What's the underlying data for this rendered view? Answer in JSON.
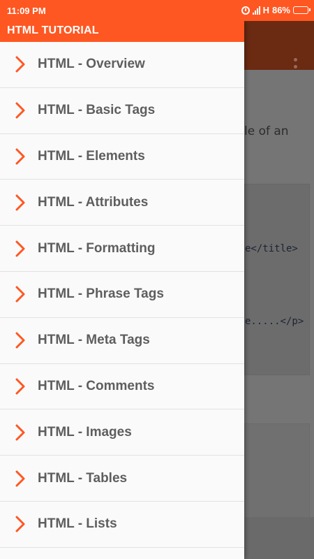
{
  "status_bar": {
    "time": "11:09 PM",
    "network": "H",
    "battery": "86%",
    "battery_level": 0.86
  },
  "drawer": {
    "title": "HTML TUTORIAL",
    "items": [
      {
        "label": "HTML - Overview"
      },
      {
        "label": "HTML - Basic Tags"
      },
      {
        "label": "HTML - Elements"
      },
      {
        "label": "HTML - Attributes"
      },
      {
        "label": "HTML - Formatting"
      },
      {
        "label": "HTML - Phrase Tags"
      },
      {
        "label": "HTML - Meta Tags"
      },
      {
        "label": "HTML - Comments"
      },
      {
        "label": "HTML - Images"
      },
      {
        "label": "HTML - Tables"
      },
      {
        "label": "HTML - Lists"
      }
    ]
  },
  "background": {
    "text_fragment": "le of an",
    "code_lines": [
      "e</title>",
      "e.....</p>"
    ]
  },
  "colors": {
    "accent": "#ff5722",
    "chevron": "#ff5722",
    "item_text": "#5e5e5e"
  },
  "icons": {
    "list_item": "chevron-right-icon",
    "overflow": "more-vert-icon"
  }
}
